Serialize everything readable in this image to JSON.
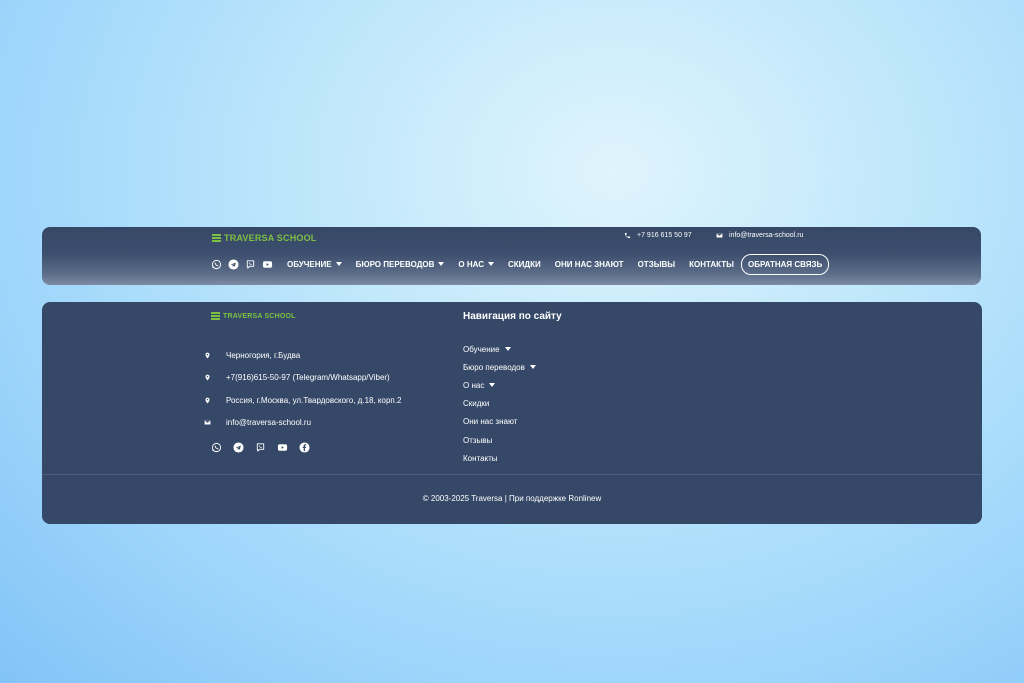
{
  "brand": {
    "name": "TRAVERSA SCHOOL",
    "accent_color": "#7cc043"
  },
  "header": {
    "phone": "+7 916 615 50 97",
    "email": "info@traversa-school.ru",
    "nav": [
      {
        "label": "ОБУЧЕНИЕ",
        "has_dropdown": true
      },
      {
        "label": "БЮРО ПЕРЕВОДОВ",
        "has_dropdown": true
      },
      {
        "label": "О НАС",
        "has_dropdown": true
      },
      {
        "label": "СКИДКИ",
        "has_dropdown": false
      },
      {
        "label": "ОНИ НАС ЗНАЮТ",
        "has_dropdown": false
      },
      {
        "label": "ОТЗЫВЫ",
        "has_dropdown": false
      },
      {
        "label": "КОНТАКТЫ",
        "has_dropdown": false
      }
    ],
    "cta_label": "ОБРАТНАЯ СВЯЗЬ",
    "social_icons": [
      "whatsapp-icon",
      "telegram-icon",
      "viber-icon",
      "youtube-icon"
    ]
  },
  "footer": {
    "contacts": [
      {
        "icon": "map-pin-icon",
        "text": "Черногория, г.Будва"
      },
      {
        "icon": "map-pin-icon",
        "text": "+7(916)615-50-97 (Telegram/Whatsapp/Viber)"
      },
      {
        "icon": "map-pin-icon",
        "text": "Россия, г.Москва, ул.Твардовского, д.18, корп.2"
      },
      {
        "icon": "envelope-icon",
        "text": "info@traversa-school.ru"
      }
    ],
    "social_icons": [
      "whatsapp-icon",
      "telegram-icon",
      "viber-icon",
      "youtube-icon",
      "facebook-icon"
    ],
    "nav_title": "Навигация по сайту",
    "nav_links": [
      {
        "label": "Обучение",
        "has_dropdown": true
      },
      {
        "label": "Бюро переводов",
        "has_dropdown": true
      },
      {
        "label": "О нас",
        "has_dropdown": true
      },
      {
        "label": "Скидки",
        "has_dropdown": false
      },
      {
        "label": "Они нас знают",
        "has_dropdown": false
      },
      {
        "label": "Отзывы",
        "has_dropdown": false
      },
      {
        "label": "Контакты",
        "has_dropdown": false
      }
    ],
    "copyright": "© 2003-2025 Traversa | При поддержке Ronlinew"
  }
}
